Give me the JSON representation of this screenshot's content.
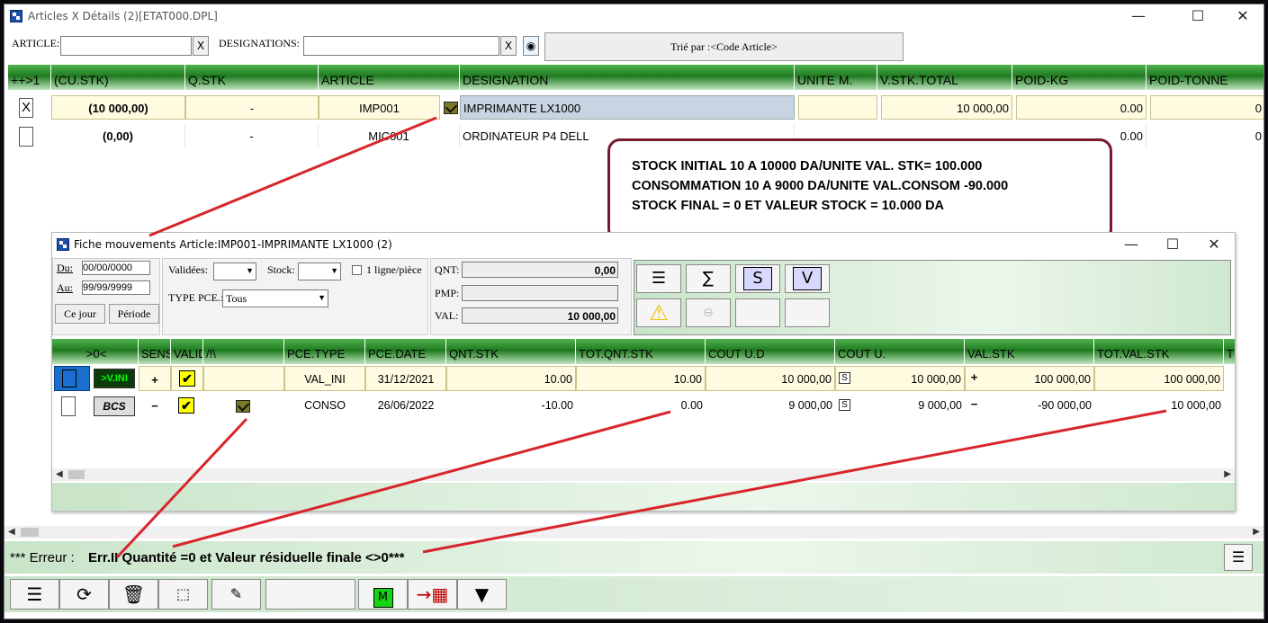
{
  "window": {
    "title": "Articles X Détails (2)[ETAT000.DPL]"
  },
  "filters": {
    "article_label": "ARTICLE:",
    "article_value": "",
    "designation_label": "DESIGNATIONS:",
    "designation_value": "",
    "clear_label": "X",
    "sort_label": "Trié par :<Code Article>"
  },
  "main_grid": {
    "headers": [
      "++>1",
      "(CU.STK)",
      "Q.STK",
      "ARTICLE",
      "DESIGNATION",
      "UNITE M.",
      "V.STK.TOTAL",
      "POID-KG",
      "POID-TONNE"
    ],
    "rows": [
      {
        "check": "X",
        "cu_stk": "(10 000,00)",
        "q_stk": "-",
        "article": "IMP001",
        "designation": "IMPRIMANTE LX1000",
        "unite": "",
        "v_stk_total": "10 000,00",
        "poid_kg": "0.00",
        "poid_tonne": "0"
      },
      {
        "check": "",
        "cu_stk": "(0,00)",
        "q_stk": "-",
        "article": "MIC001",
        "designation": "ORDINATEUR P4 DELL",
        "unite": "",
        "v_stk_total": "",
        "poid_kg": "0.00",
        "poid_tonne": "0"
      }
    ]
  },
  "annotation": {
    "line1": "STOCK INITIAL   10 A 10000  DA/UNITE    VAL. STK= 100.000",
    "line2": "CONSOMMATION 10 A 9000 DA/UNITE  VAL.CONSOM -90.000",
    "line3": "STOCK FINAL = 0  ET VALEUR STOCK = 10.000 DA"
  },
  "sub_window": {
    "title": "Fiche mouvements Article:IMP001-IMPRIMANTE LX1000  (2)",
    "du_label": "Du:",
    "du_value": "00/00/0000",
    "au_label": "Au:",
    "au_value": "99/99/9999",
    "ce_jour": "Ce jour",
    "periode": "Période",
    "validees_label": "Validées:",
    "stock_label": "Stock:",
    "ligne_label": "1 ligne/pièce",
    "type_pce_label": "TYPE PCE.:",
    "type_pce_value": "Tous",
    "qnt_label": "QNT:",
    "qnt_value": "0,00",
    "pmp_label": "PMP:",
    "pmp_value": "",
    "val_label": "VAL:",
    "val_value": "10 000,00",
    "headers": [
      ">0<",
      "SENS",
      "VALID",
      "/!\\",
      "PCE.TYPE",
      "PCE.DATE",
      "QNT.STK",
      "TOT.QNT.STK",
      "COUT U.D",
      "COUT U.",
      "VAL.STK",
      "TOT.VAL.STK",
      "T"
    ],
    "rows": [
      {
        "badge": ">V.INI",
        "sens": "+",
        "valid": "✔",
        "pce_type": "VAL_INI",
        "pce_date": "31/12/2021",
        "qnt_stk": "10.00",
        "tot_qnt": "10.00",
        "cout_ud": "10 000,00",
        "s": "S",
        "cout_u": "10 000,00",
        "sign": "+",
        "val_stk": "100 000,00",
        "tot_val": "100 000,00"
      },
      {
        "badge": "BCS",
        "sens": "−",
        "valid": "✔",
        "pce_type": "CONSO",
        "pce_date": "26/06/2022",
        "qnt_stk": "-10.00",
        "tot_qnt": "0.00",
        "cout_ud": "9 000,00",
        "s": "S",
        "cout_u": "9 000,00",
        "sign": "−",
        "val_stk": "-90 000,00",
        "tot_val": "10 000,00"
      }
    ],
    "tool_s": "S",
    "tool_v": "V"
  },
  "status": {
    "prefix": "*** Erreur  :",
    "message": "Err.II Quantité =0 et Valeur résiduelle finale <>0***"
  },
  "colors": {
    "header_green": "#1f7a1f",
    "annotation_border": "#7a1830",
    "arrow_red": "#d7262b"
  }
}
